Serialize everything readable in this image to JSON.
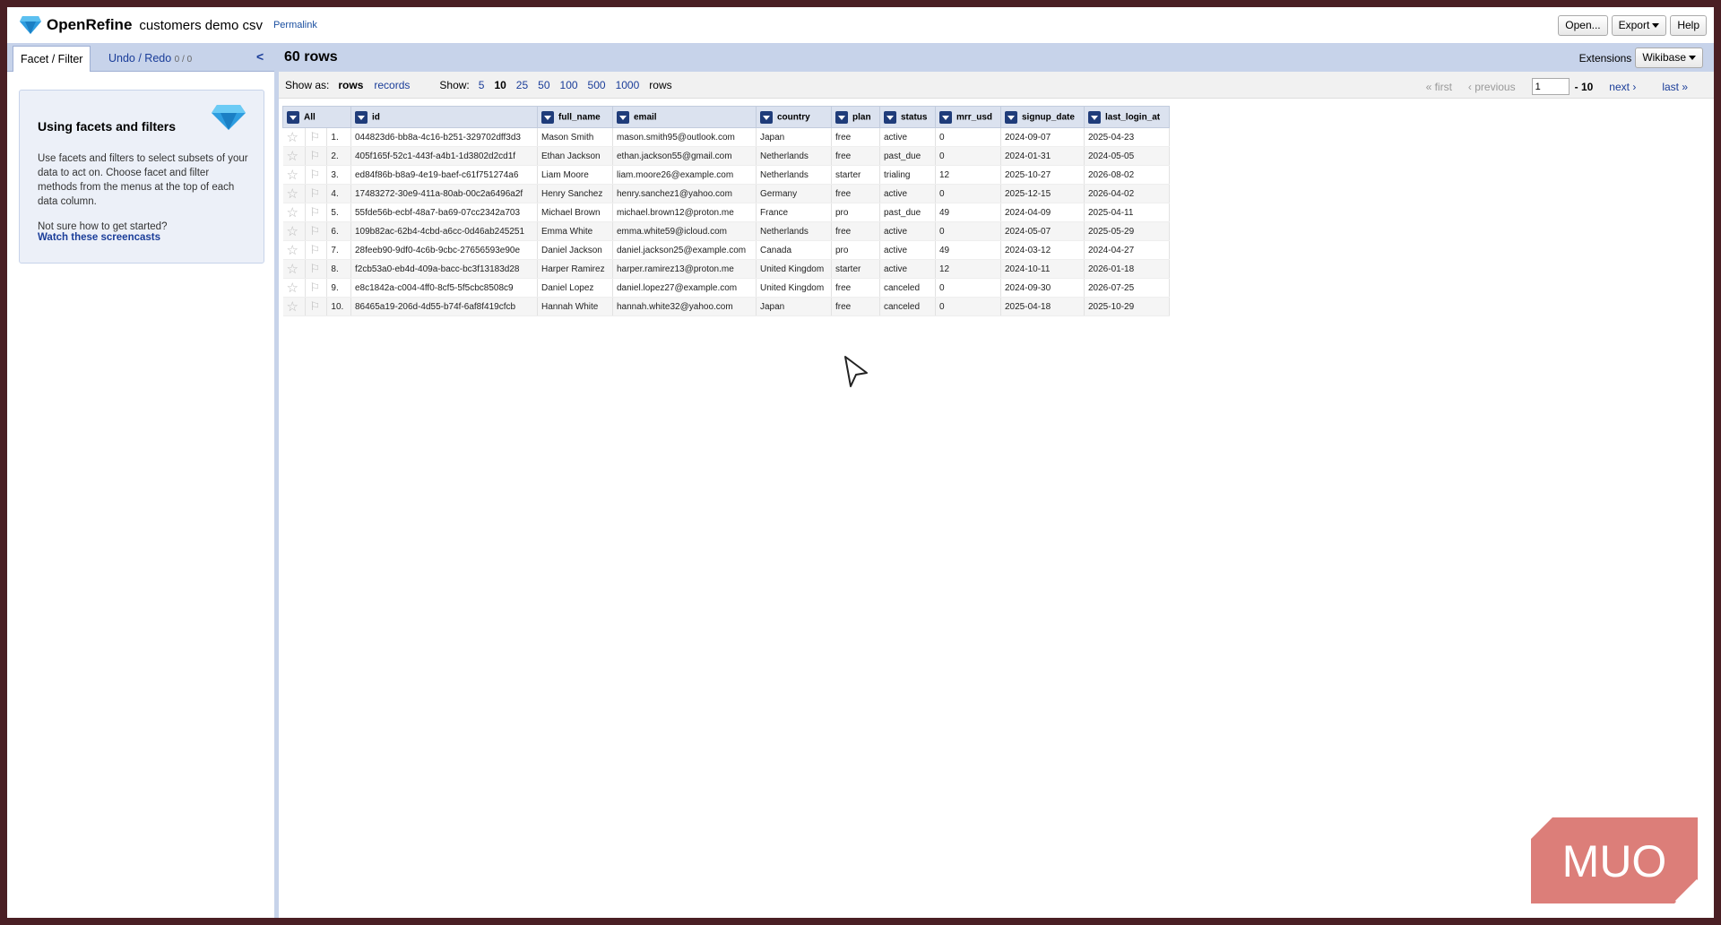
{
  "header": {
    "app_name": "OpenRefine",
    "project_name": "customers demo csv",
    "permalink": "Permalink",
    "buttons": {
      "open": "Open...",
      "export": "Export",
      "help": "Help"
    }
  },
  "left_panel": {
    "tab_facet": "Facet / Filter",
    "tab_undo": "Undo / Redo",
    "undo_count": "0 / 0",
    "help_title": "Using facets and filters",
    "help_text": "Use facets and filters to select subsets of your data to act on. Choose facet and filter methods from the menus at the top of each data column.",
    "help_question": "Not sure how to get started?",
    "help_link": "Watch these screencasts"
  },
  "main": {
    "row_count": "60 rows",
    "extensions_label": "Extensions",
    "extensions_value": "Wikibase",
    "show_as_label": "Show as:",
    "show_as_rows": "rows",
    "show_as_records": "records",
    "show_label": "Show:",
    "page_sizes": [
      "5",
      "10",
      "25",
      "50",
      "100",
      "500",
      "1000"
    ],
    "selected_page_size": "10",
    "rows_suffix": "rows",
    "pager": {
      "first": "« first",
      "previous": "‹ previous",
      "page": "1",
      "range": "- 10",
      "next": "next ›",
      "last": "last »"
    }
  },
  "table": {
    "all_label": "All",
    "columns": [
      "id",
      "full_name",
      "email",
      "country",
      "plan",
      "status",
      "mrr_usd",
      "signup_date",
      "last_login_at"
    ],
    "rows": [
      [
        "1.",
        "044823d6-bb8a-4c16-b251-329702dff3d3",
        "Mason Smith",
        "mason.smith95@outlook.com",
        "Japan",
        "free",
        "active",
        "0",
        "2024-09-07",
        "2025-04-23"
      ],
      [
        "2.",
        "405f165f-52c1-443f-a4b1-1d3802d2cd1f",
        "Ethan Jackson",
        "ethan.jackson55@gmail.com",
        "Netherlands",
        "free",
        "past_due",
        "0",
        "2024-01-31",
        "2024-05-05"
      ],
      [
        "3.",
        "ed84f86b-b8a9-4e19-baef-c61f751274a6",
        "Liam Moore",
        "liam.moore26@example.com",
        "Netherlands",
        "starter",
        "trialing",
        "12",
        "2025-10-27",
        "2026-08-02"
      ],
      [
        "4.",
        "17483272-30e9-411a-80ab-00c2a6496a2f",
        "Henry Sanchez",
        "henry.sanchez1@yahoo.com",
        "Germany",
        "free",
        "active",
        "0",
        "2025-12-15",
        "2026-04-02"
      ],
      [
        "5.",
        "55fde56b-ecbf-48a7-ba69-07cc2342a703",
        "Michael Brown",
        "michael.brown12@proton.me",
        "France",
        "pro",
        "past_due",
        "49",
        "2024-04-09",
        "2025-04-11"
      ],
      [
        "6.",
        "109b82ac-62b4-4cbd-a6cc-0d46ab245251",
        "Emma White",
        "emma.white59@icloud.com",
        "Netherlands",
        "free",
        "active",
        "0",
        "2024-05-07",
        "2025-05-29"
      ],
      [
        "7.",
        "28feeb90-9df0-4c6b-9cbc-27656593e90e",
        "Daniel Jackson",
        "daniel.jackson25@example.com",
        "Canada",
        "pro",
        "active",
        "49",
        "2024-03-12",
        "2024-04-27"
      ],
      [
        "8.",
        "f2cb53a0-eb4d-409a-bacc-bc3f13183d28",
        "Harper Ramirez",
        "harper.ramirez13@proton.me",
        "United Kingdom",
        "starter",
        "active",
        "12",
        "2024-10-11",
        "2026-01-18"
      ],
      [
        "9.",
        "e8c1842a-c004-4ff0-8cf5-5f5cbc8508c9",
        "Daniel Lopez",
        "daniel.lopez27@example.com",
        "United Kingdom",
        "free",
        "canceled",
        "0",
        "2024-09-30",
        "2026-07-25"
      ],
      [
        "10.",
        "86465a19-206d-4d55-b74f-6af8f419cfcb",
        "Hannah White",
        "hannah.white32@yahoo.com",
        "Japan",
        "free",
        "canceled",
        "0",
        "2025-04-18",
        "2025-10-29"
      ]
    ]
  },
  "watermark": "MUO",
  "colors": {
    "accent": "#c7d3ea",
    "link": "#1a3d99",
    "watermark": "#d9736e"
  }
}
